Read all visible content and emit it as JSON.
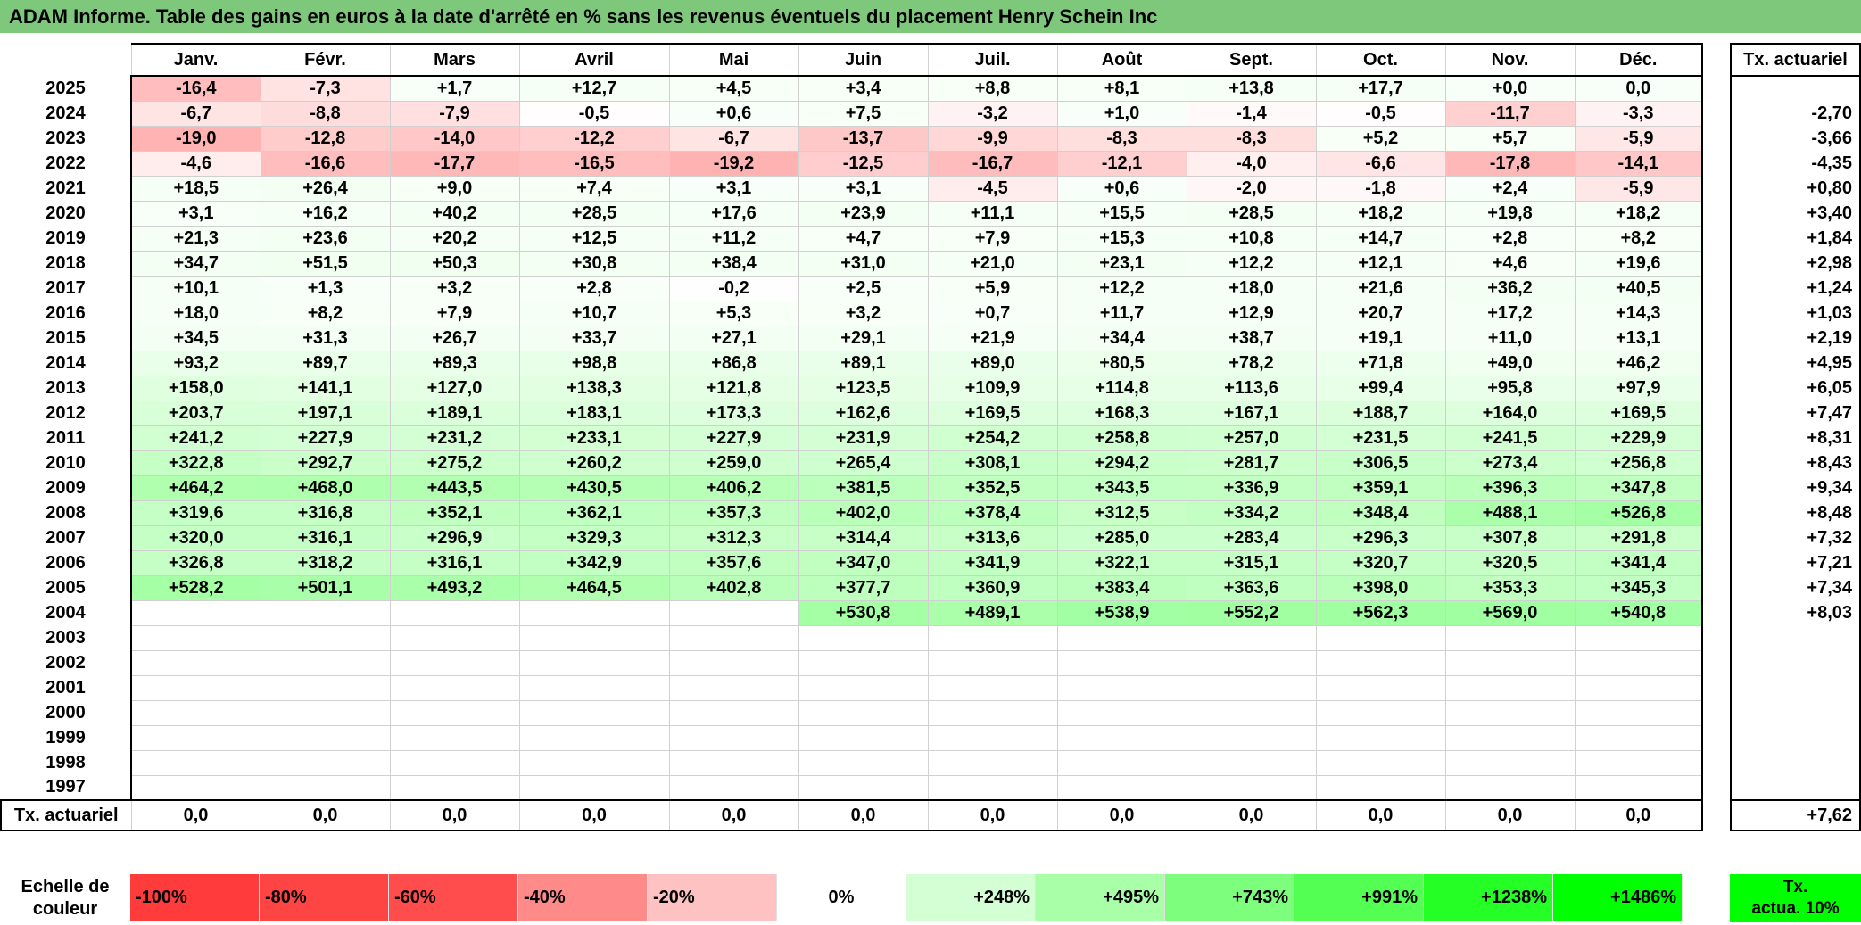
{
  "title": "ADAM Informe. Table des gains en euros à la date d'arrêté en % sans les revenus éventuels du placement Henry Schein Inc",
  "months": [
    "Janv.",
    "Févr.",
    "Mars",
    "Avril",
    "Mai",
    "Juin",
    "Juil.",
    "Août",
    "Sept.",
    "Oct.",
    "Nov.",
    "Déc."
  ],
  "tx_header": "Tx. actuariel",
  "rows": [
    {
      "year": "2025",
      "cells": [
        "-16,4",
        "-7,3",
        "+1,7",
        "+12,7",
        "+4,5",
        "+3,4",
        "+8,8",
        "+8,1",
        "+13,8",
        "+17,7",
        "+0,0",
        "0,0"
      ],
      "tx": ""
    },
    {
      "year": "2024",
      "cells": [
        "-6,7",
        "-8,8",
        "-7,9",
        "-0,5",
        "+0,6",
        "+7,5",
        "-3,2",
        "+1,0",
        "-1,4",
        "-0,5",
        "-11,7",
        "-3,3"
      ],
      "tx": "-2,70"
    },
    {
      "year": "2023",
      "cells": [
        "-19,0",
        "-12,8",
        "-14,0",
        "-12,2",
        "-6,7",
        "-13,7",
        "-9,9",
        "-8,3",
        "-8,3",
        "+5,2",
        "+5,7",
        "-5,9"
      ],
      "tx": "-3,66"
    },
    {
      "year": "2022",
      "cells": [
        "-4,6",
        "-16,6",
        "-17,7",
        "-16,5",
        "-19,2",
        "-12,5",
        "-16,7",
        "-12,1",
        "-4,0",
        "-6,6",
        "-17,8",
        "-14,1"
      ],
      "tx": "-4,35"
    },
    {
      "year": "2021",
      "cells": [
        "+18,5",
        "+26,4",
        "+9,0",
        "+7,4",
        "+3,1",
        "+3,1",
        "-4,5",
        "+0,6",
        "-2,0",
        "-1,8",
        "+2,4",
        "-5,9"
      ],
      "tx": "+0,80"
    },
    {
      "year": "2020",
      "cells": [
        "+3,1",
        "+16,2",
        "+40,2",
        "+28,5",
        "+17,6",
        "+23,9",
        "+11,1",
        "+15,5",
        "+28,5",
        "+18,2",
        "+19,8",
        "+18,2"
      ],
      "tx": "+3,40"
    },
    {
      "year": "2019",
      "cells": [
        "+21,3",
        "+23,6",
        "+20,2",
        "+12,5",
        "+11,2",
        "+4,7",
        "+7,9",
        "+15,3",
        "+10,8",
        "+14,7",
        "+2,8",
        "+8,2"
      ],
      "tx": "+1,84"
    },
    {
      "year": "2018",
      "cells": [
        "+34,7",
        "+51,5",
        "+50,3",
        "+30,8",
        "+38,4",
        "+31,0",
        "+21,0",
        "+23,1",
        "+12,2",
        "+12,1",
        "+4,6",
        "+19,6"
      ],
      "tx": "+2,98"
    },
    {
      "year": "2017",
      "cells": [
        "+10,1",
        "+1,3",
        "+3,2",
        "+2,8",
        "-0,2",
        "+2,5",
        "+5,9",
        "+12,2",
        "+18,0",
        "+21,6",
        "+36,2",
        "+40,5"
      ],
      "tx": "+1,24"
    },
    {
      "year": "2016",
      "cells": [
        "+18,0",
        "+8,2",
        "+7,9",
        "+10,7",
        "+5,3",
        "+3,2",
        "+0,7",
        "+11,7",
        "+12,9",
        "+20,7",
        "+17,2",
        "+14,3"
      ],
      "tx": "+1,03"
    },
    {
      "year": "2015",
      "cells": [
        "+34,5",
        "+31,3",
        "+26,7",
        "+33,7",
        "+27,1",
        "+29,1",
        "+21,9",
        "+34,4",
        "+38,7",
        "+19,1",
        "+11,0",
        "+13,1"
      ],
      "tx": "+2,19"
    },
    {
      "year": "2014",
      "cells": [
        "+93,2",
        "+89,7",
        "+89,3",
        "+98,8",
        "+86,8",
        "+89,1",
        "+89,0",
        "+80,5",
        "+78,2",
        "+71,8",
        "+49,0",
        "+46,2"
      ],
      "tx": "+4,95"
    },
    {
      "year": "2013",
      "cells": [
        "+158,0",
        "+141,1",
        "+127,0",
        "+138,3",
        "+121,8",
        "+123,5",
        "+109,9",
        "+114,8",
        "+113,6",
        "+99,4",
        "+95,8",
        "+97,9"
      ],
      "tx": "+6,05"
    },
    {
      "year": "2012",
      "cells": [
        "+203,7",
        "+197,1",
        "+189,1",
        "+183,1",
        "+173,3",
        "+162,6",
        "+169,5",
        "+168,3",
        "+167,1",
        "+188,7",
        "+164,0",
        "+169,5"
      ],
      "tx": "+7,47"
    },
    {
      "year": "2011",
      "cells": [
        "+241,2",
        "+227,9",
        "+231,2",
        "+233,1",
        "+227,9",
        "+231,9",
        "+254,2",
        "+258,8",
        "+257,0",
        "+231,5",
        "+241,5",
        "+229,9"
      ],
      "tx": "+8,31"
    },
    {
      "year": "2010",
      "cells": [
        "+322,8",
        "+292,7",
        "+275,2",
        "+260,2",
        "+259,0",
        "+265,4",
        "+308,1",
        "+294,2",
        "+281,7",
        "+306,5",
        "+273,4",
        "+256,8"
      ],
      "tx": "+8,43"
    },
    {
      "year": "2009",
      "cells": [
        "+464,2",
        "+468,0",
        "+443,5",
        "+430,5",
        "+406,2",
        "+381,5",
        "+352,5",
        "+343,5",
        "+336,9",
        "+359,1",
        "+396,3",
        "+347,8"
      ],
      "tx": "+9,34"
    },
    {
      "year": "2008",
      "cells": [
        "+319,6",
        "+316,8",
        "+352,1",
        "+362,1",
        "+357,3",
        "+402,0",
        "+378,4",
        "+312,5",
        "+334,2",
        "+348,4",
        "+488,1",
        "+526,8"
      ],
      "tx": "+8,48"
    },
    {
      "year": "2007",
      "cells": [
        "+320,0",
        "+316,1",
        "+296,9",
        "+329,3",
        "+312,3",
        "+314,4",
        "+313,6",
        "+285,0",
        "+283,4",
        "+296,3",
        "+307,8",
        "+291,8"
      ],
      "tx": "+7,32"
    },
    {
      "year": "2006",
      "cells": [
        "+326,8",
        "+318,2",
        "+316,1",
        "+342,9",
        "+357,6",
        "+347,0",
        "+341,9",
        "+322,1",
        "+315,1",
        "+320,7",
        "+320,5",
        "+341,4"
      ],
      "tx": "+7,21"
    },
    {
      "year": "2005",
      "cells": [
        "+528,2",
        "+501,1",
        "+493,2",
        "+464,5",
        "+402,8",
        "+377,7",
        "+360,9",
        "+383,4",
        "+363,6",
        "+398,0",
        "+353,3",
        "+345,3"
      ],
      "tx": "+7,34"
    },
    {
      "year": "2004",
      "cells": [
        "",
        "",
        "",
        "",
        "",
        "+530,8",
        "+489,1",
        "+538,9",
        "+552,2",
        "+562,3",
        "+569,0",
        "+540,8"
      ],
      "tx": "+8,03"
    },
    {
      "year": "2003",
      "cells": [
        "",
        "",
        "",
        "",
        "",
        "",
        "",
        "",
        "",
        "",
        "",
        ""
      ],
      "tx": ""
    },
    {
      "year": "2002",
      "cells": [
        "",
        "",
        "",
        "",
        "",
        "",
        "",
        "",
        "",
        "",
        "",
        ""
      ],
      "tx": ""
    },
    {
      "year": "2001",
      "cells": [
        "",
        "",
        "",
        "",
        "",
        "",
        "",
        "",
        "",
        "",
        "",
        ""
      ],
      "tx": ""
    },
    {
      "year": "2000",
      "cells": [
        "",
        "",
        "",
        "",
        "",
        "",
        "",
        "",
        "",
        "",
        "",
        ""
      ],
      "tx": ""
    },
    {
      "year": "1999",
      "cells": [
        "",
        "",
        "",
        "",
        "",
        "",
        "",
        "",
        "",
        "",
        "",
        ""
      ],
      "tx": ""
    },
    {
      "year": "1998",
      "cells": [
        "",
        "",
        "",
        "",
        "",
        "",
        "",
        "",
        "",
        "",
        "",
        ""
      ],
      "tx": ""
    },
    {
      "year": "1997",
      "cells": [
        "",
        "",
        "",
        "",
        "",
        "",
        "",
        "",
        "",
        "",
        "",
        ""
      ],
      "tx": ""
    }
  ],
  "summary": {
    "label": "Tx. actuariel",
    "cells": [
      "0,0",
      "0,0",
      "0,0",
      "0,0",
      "0,0",
      "0,0",
      "0,0",
      "0,0",
      "0,0",
      "0,0",
      "0,0",
      "0,0"
    ],
    "tx": "+7,62"
  },
  "scale": {
    "label_line1": "Echelle de",
    "label_line2": "couleur",
    "steps": [
      {
        "label": "-100%",
        "color": "#ff3b3b"
      },
      {
        "label": "-80%",
        "color": "#ff4444"
      },
      {
        "label": "-60%",
        "color": "#ff4d4d"
      },
      {
        "label": "-40%",
        "color": "#ff8a8a"
      },
      {
        "label": "-20%",
        "color": "#ffc2c2"
      },
      {
        "label": "0%",
        "color": "#ffffff"
      },
      {
        "label": "+248%",
        "color": "#d4ffd4"
      },
      {
        "label": "+495%",
        "color": "#a8ffa8"
      },
      {
        "label": "+743%",
        "color": "#7dff7d"
      },
      {
        "label": "+991%",
        "color": "#52ff52"
      },
      {
        "label": "+1238%",
        "color": "#26ff26"
      },
      {
        "label": "+1486%",
        "color": "#00ff00"
      }
    ],
    "tx_line1": "Tx.",
    "tx_line2": "actua. 10%"
  },
  "colors": {
    "title_bg": "#7ec87c",
    "neg_strong": "#ffb3b3",
    "pos_strong": "#a6ffa6"
  }
}
